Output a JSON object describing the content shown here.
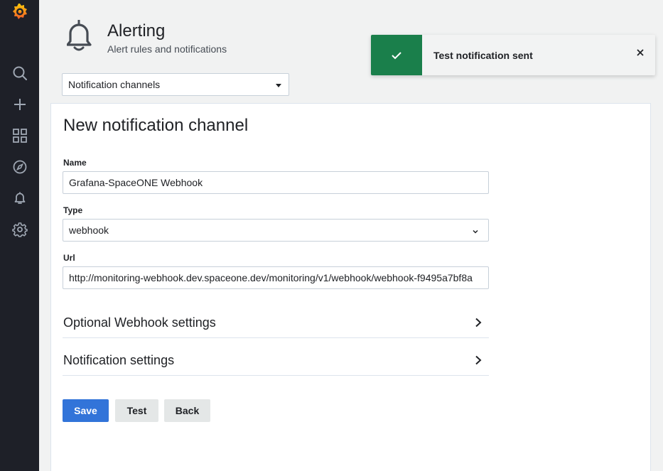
{
  "sidemenu": {
    "items": [
      "grafana-logo-icon",
      "search-icon",
      "plus-icon",
      "dashboards-icon",
      "explore-compass-icon",
      "alerting-bell-icon",
      "configuration-gear-icon"
    ],
    "logo_color": "#f05a28",
    "icon_color": "#9fa7b3"
  },
  "header": {
    "title": "Alerting",
    "subtitle": "Alert rules and notifications",
    "icon": "bell-icon"
  },
  "nav_select": {
    "value": "Notification channels"
  },
  "form": {
    "title": "New notification channel",
    "name_label": "Name",
    "name_value": "Grafana-SpaceONE Webhook",
    "type_label": "Type",
    "type_value": "webhook",
    "url_label": "Url",
    "url_value": "http://monitoring-webhook.dev.spaceone.dev/monitoring/v1/webhook/webhook-f9495a7bf8a"
  },
  "sections": {
    "optional_webhook": "Optional Webhook settings",
    "notification_settings": "Notification settings"
  },
  "buttons": {
    "save": "Save",
    "test": "Test",
    "back": "Back"
  },
  "toast": {
    "message": "Test notification sent",
    "status": "success",
    "color": "#1a7f4b"
  }
}
